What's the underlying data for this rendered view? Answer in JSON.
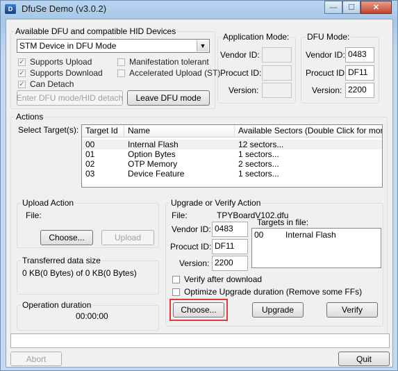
{
  "window": {
    "title": "DfuSe Demo (v3.0.2)",
    "app_icon_glyph": "D",
    "minimize_glyph": "—",
    "maximize_glyph": "☐",
    "close_glyph": "✕"
  },
  "devices": {
    "group_label": "Available DFU and compatible HID Devices",
    "selected_device": "STM Device in DFU Mode",
    "combo_arrow_glyph": "▼",
    "check_glyph": "✓",
    "checkboxes": {
      "supports_upload": "Supports Upload",
      "supports_download": "Supports Download",
      "can_detach": "Can Detach",
      "manifestation_tolerant": "Manifestation tolerant",
      "accelerated_upload": "Accelerated Upload (ST)"
    },
    "enter_dfu_button": "Enter DFU mode/HID detach",
    "leave_dfu_button": "Leave DFU mode"
  },
  "application_mode": {
    "group_label": "Application Mode:",
    "vendor_label": "Vendor ID:",
    "product_label": "Procuct ID:",
    "version_label": "Version:",
    "vendor_value": "",
    "product_value": "",
    "version_value": ""
  },
  "dfu_mode": {
    "group_label": "DFU Mode:",
    "vendor_label": "Vendor ID:",
    "product_label": "Procuct ID:",
    "version_label": "Version:",
    "vendor_value": "0483",
    "product_value": "DF11",
    "version_value": "2200"
  },
  "actions": {
    "group_label": "Actions",
    "select_targets_label": "Select Target(s):",
    "columns": [
      "Target Id",
      "Name",
      "Available Sectors (Double Click for more)"
    ],
    "targets": [
      {
        "id": "00",
        "name": "Internal Flash",
        "sectors": "12 sectors..."
      },
      {
        "id": "01",
        "name": "Option Bytes",
        "sectors": "1 sectors..."
      },
      {
        "id": "02",
        "name": "OTP Memory",
        "sectors": "2 sectors..."
      },
      {
        "id": "03",
        "name": "Device Feature",
        "sectors": "1 sectors..."
      }
    ]
  },
  "upload_action": {
    "group_label": "Upload Action",
    "file_label": "File:",
    "file_value": "",
    "choose_button": "Choose...",
    "upload_button": "Upload"
  },
  "transferred": {
    "group_label": "Transferred data size",
    "value": "0 KB(0 Bytes) of 0 KB(0 Bytes)"
  },
  "operation_duration": {
    "group_label": "Operation duration",
    "value": "00:00:00"
  },
  "upgrade_verify": {
    "group_label": "Upgrade or Verify Action",
    "file_label": "File:",
    "file_value": "TPYBoardV102.dfu",
    "vendor_label": "Vendor ID:",
    "product_label": "Procuct ID:",
    "version_label": "Version:",
    "vendor_value": "0483",
    "product_value": "DF11",
    "version_value": "2200",
    "targets_in_file_label": "Targets in file:",
    "targets_in_file": [
      {
        "id": "00",
        "name": "Internal Flash"
      }
    ],
    "verify_after_download": "Verify after download",
    "optimize_upgrade": "Optimize Upgrade duration (Remove some FFs)",
    "choose_button": "Choose...",
    "upgrade_button": "Upgrade",
    "verify_button": "Verify"
  },
  "footer": {
    "status_text": "",
    "abort_button": "Abort",
    "quit_button": "Quit"
  },
  "colors": {
    "highlight_border": "#e03b3b"
  }
}
